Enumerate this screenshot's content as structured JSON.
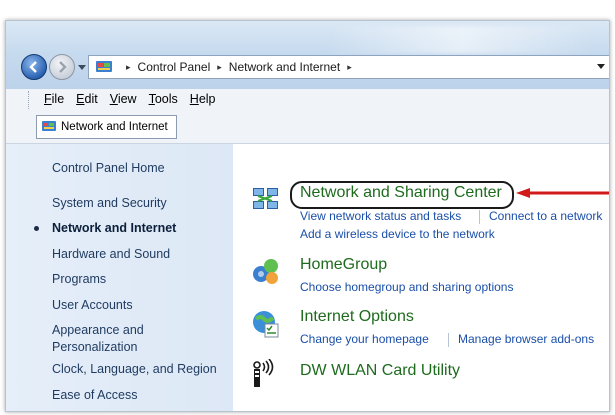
{
  "address_bar": {
    "crumbs": [
      "Control Panel",
      "Network and Internet"
    ],
    "separator": "▸"
  },
  "menu": {
    "items": [
      {
        "accel": "F",
        "rest": "ile"
      },
      {
        "accel": "E",
        "rest": "dit"
      },
      {
        "accel": "V",
        "rest": "iew"
      },
      {
        "accel": "T",
        "rest": "ools"
      },
      {
        "accel": "H",
        "rest": "elp"
      }
    ]
  },
  "tab": {
    "label": "Network and Internet"
  },
  "sidebar": {
    "items": [
      {
        "label": "Control Panel Home"
      },
      {
        "label": "System and Security"
      },
      {
        "label": "Network and Internet",
        "active": true
      },
      {
        "label": "Hardware and Sound"
      },
      {
        "label": "Programs"
      },
      {
        "label": "User Accounts"
      },
      {
        "label": "Appearance and"
      },
      {
        "label": "Personalization"
      },
      {
        "label": "Clock, Language, and Region"
      },
      {
        "label": "Ease of Access"
      }
    ]
  },
  "categories": [
    {
      "title": "Network and Sharing Center",
      "icon": "network-sharing-icon",
      "links": [
        "View network status and tasks",
        "Connect to a network",
        "Add a wireless device to the network"
      ]
    },
    {
      "title": "HomeGroup",
      "icon": "homegroup-icon",
      "links": [
        "Choose homegroup and sharing options"
      ]
    },
    {
      "title": "Internet Options",
      "icon": "internet-options-icon",
      "links": [
        "Change your homepage",
        "Manage browser add-ons"
      ]
    },
    {
      "title": "DW WLAN Card Utility",
      "icon": "wlan-utility-icon",
      "links": []
    }
  ],
  "annotation": {
    "arrow_color": "#d11a1a",
    "highlight_color": "#1a1a1a"
  },
  "colors": {
    "category_title": "#1e6b1e",
    "link": "#1a4fa8",
    "sidebar_bg": "#e3edf8"
  }
}
